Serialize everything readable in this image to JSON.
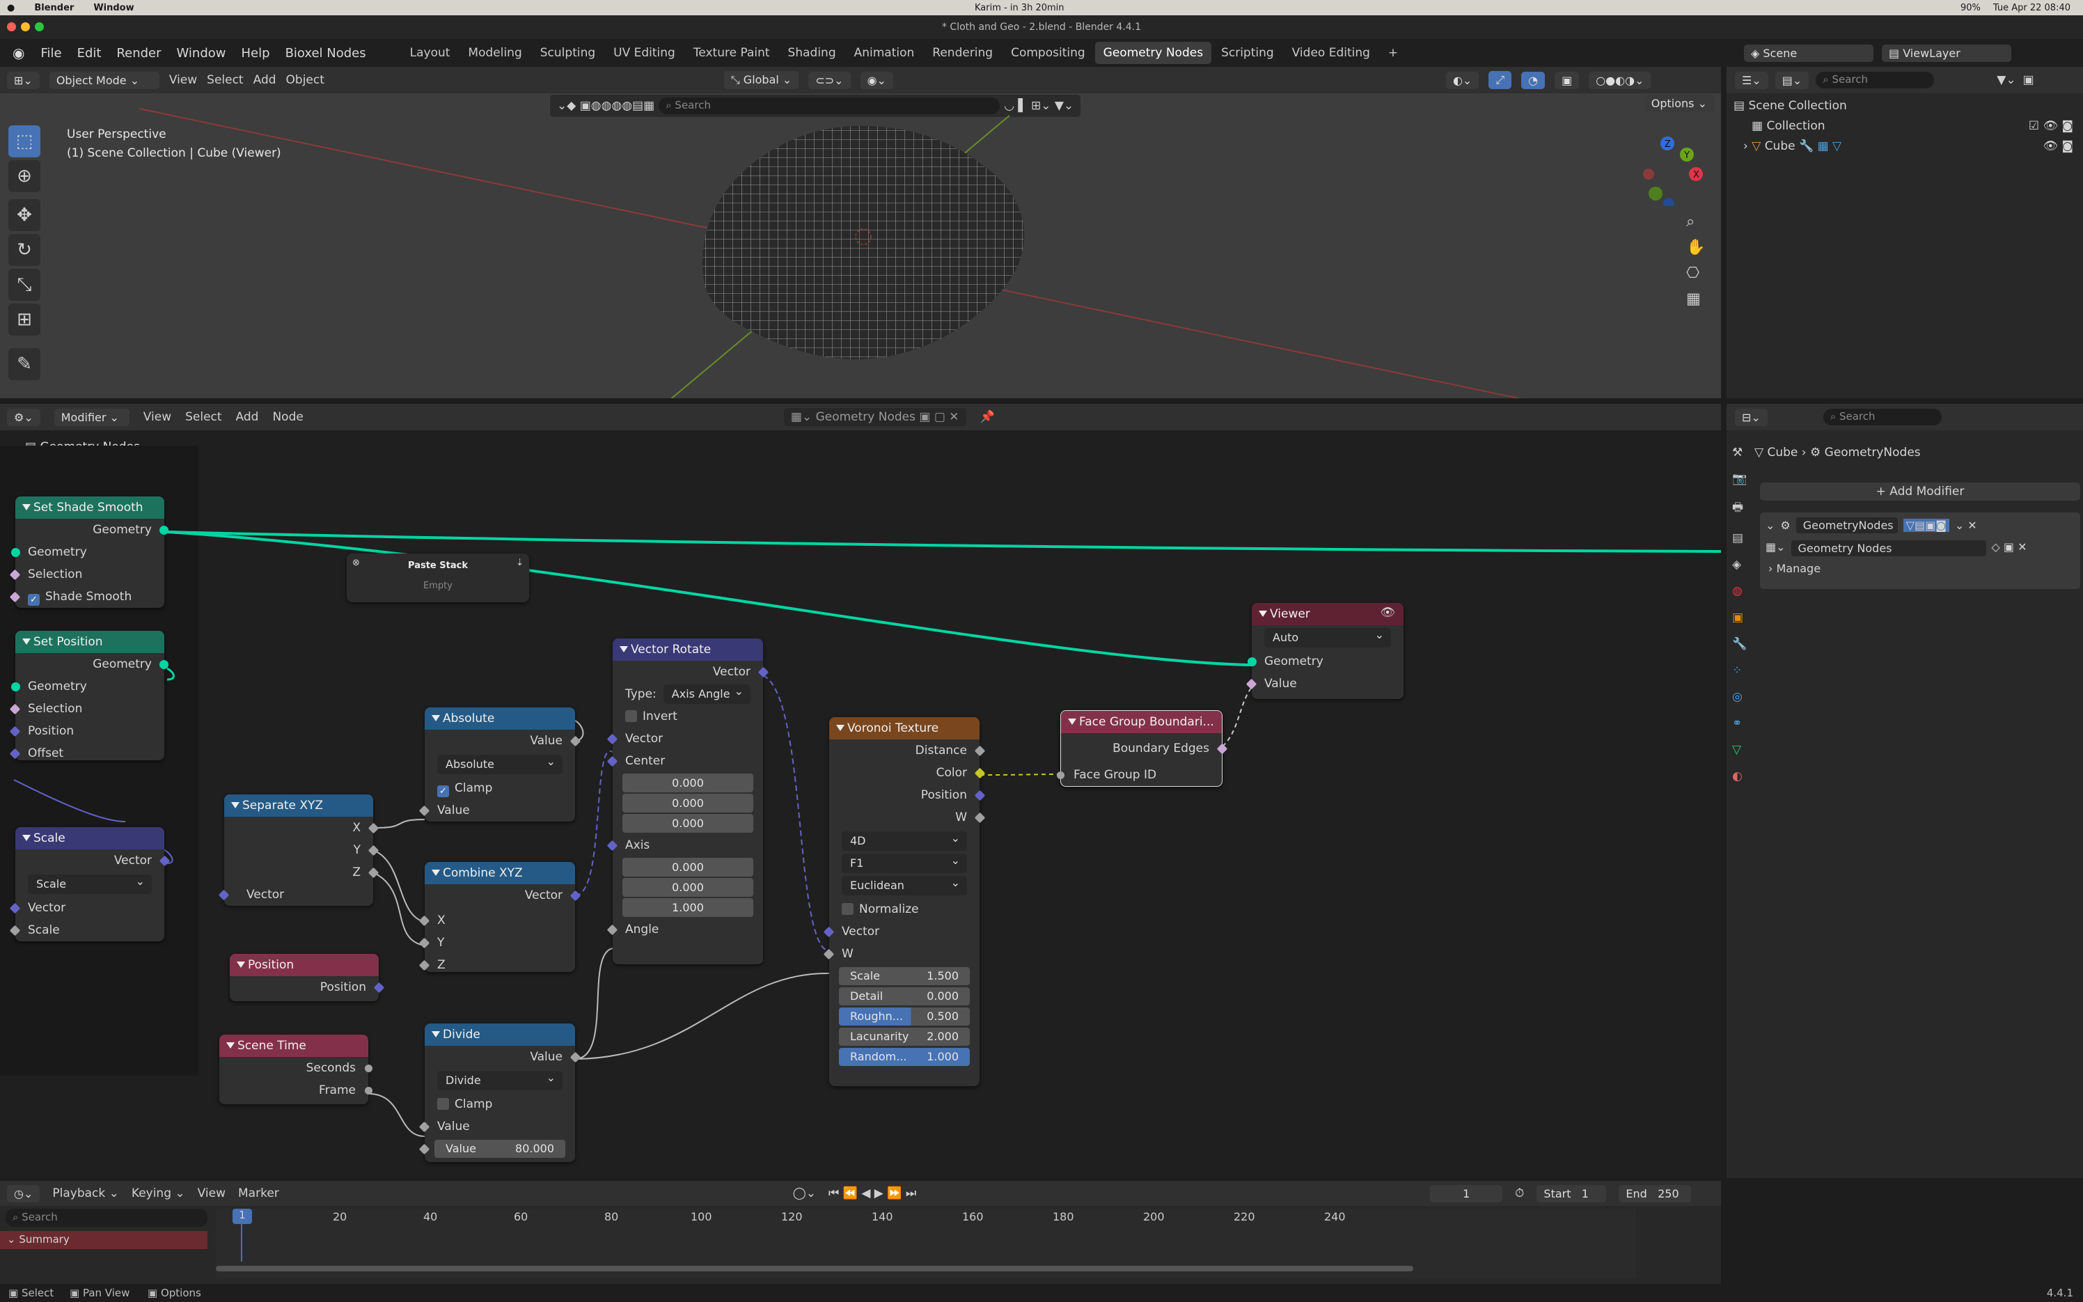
{
  "mac": {
    "app": "Blender",
    "menu_window": "Window",
    "center": "Karim - in 3h 20min",
    "battery": "90%",
    "date": "Tue Apr 22  08:40"
  },
  "window": {
    "title": "* Cloth and Geo - 2.blend - Blender 4.4.1"
  },
  "menu": {
    "file": "File",
    "edit": "Edit",
    "render": "Render",
    "window": "Window",
    "help": "Help",
    "addon": "Bioxel Nodes"
  },
  "workspaces": [
    "Layout",
    "Modeling",
    "Sculpting",
    "UV Editing",
    "Texture Paint",
    "Shading",
    "Animation",
    "Rendering",
    "Compositing",
    "Geometry Nodes",
    "Scripting",
    "Video Editing"
  ],
  "scene": {
    "name": "Scene",
    "viewlayer": "ViewLayer"
  },
  "viewport": {
    "mode": "Object Mode",
    "view": "View",
    "select": "Select",
    "add": "Add",
    "object": "Object",
    "transform": "Global",
    "search_placeholder": "Search",
    "options": "Options",
    "info1": "User Perspective",
    "info2": "(1) Scene Collection | Cube (Viewer)"
  },
  "outliner": {
    "search_placeholder": "Search",
    "root": "Scene Collection",
    "collection": "Collection",
    "object": "Cube"
  },
  "node_editor": {
    "type": "Modifier",
    "view": "View",
    "select": "Select",
    "add": "Add",
    "node": "Node",
    "tree_name": "Geometry Nodes",
    "breadcrumb": "Geometry Nodes"
  },
  "nodes": {
    "shade_smooth": {
      "title": "Set Shade Smooth",
      "out": "Geometry",
      "in1": "Geometry",
      "in2": "Selection",
      "in3": "Shade Smooth"
    },
    "set_position": {
      "title": "Set Position",
      "out": "Geometry",
      "in1": "Geometry",
      "in2": "Selection",
      "in3": "Position",
      "in4": "Offset"
    },
    "scale": {
      "title": "Scale",
      "out": "Vector",
      "mode": "Scale",
      "in1": "Vector",
      "in2": "Scale"
    },
    "paste": {
      "title": "Paste Stack",
      "body": "Empty"
    },
    "separate": {
      "title": "Separate XYZ",
      "x": "X",
      "y": "Y",
      "z": "Z",
      "in": "Vector"
    },
    "position": {
      "title": "Position",
      "out": "Position"
    },
    "scene_time": {
      "title": "Scene Time",
      "s": "Seconds",
      "f": "Frame"
    },
    "absolute": {
      "title": "Absolute",
      "out": "Value",
      "mode": "Absolute",
      "clamp": "Clamp",
      "in": "Value"
    },
    "combine": {
      "title": "Combine XYZ",
      "out": "Vector",
      "x": "X",
      "y": "Y",
      "z": "Z"
    },
    "divide": {
      "title": "Divide",
      "out": "Value",
      "mode": "Divide",
      "clamp": "Clamp",
      "in": "Value",
      "vlabel": "Value",
      "vval": "80.000"
    },
    "vrot": {
      "title": "Vector Rotate",
      "out": "Vector",
      "type_label": "Type:",
      "type": "Axis Angle",
      "invert": "Invert",
      "vec": "Vector",
      "center": "Center",
      "c1": "0.000",
      "c2": "0.000",
      "c3": "0.000",
      "axis": "Axis",
      "a1": "0.000",
      "a2": "0.000",
      "a3": "1.000",
      "angle": "Angle"
    },
    "voronoi": {
      "title": "Voronoi Texture",
      "o1": "Distance",
      "o2": "Color",
      "o3": "Position",
      "o4": "W",
      "dim": "4D",
      "feat": "F1",
      "metric": "Euclidean",
      "norm": "Normalize",
      "vec": "Vector",
      "w": "W",
      "scale_l": "Scale",
      "scale_v": "1.500",
      "detail_l": "Detail",
      "detail_v": "0.000",
      "rough_l": "Roughn...",
      "rough_v": "0.500",
      "lac_l": "Lacunarity",
      "lac_v": "2.000",
      "rand_l": "Random...",
      "rand_v": "1.000"
    },
    "fgb": {
      "title": "Face Group Boundari...",
      "out": "Boundary Edges",
      "in": "Face Group ID"
    },
    "viewer": {
      "title": "Viewer",
      "mode": "Auto",
      "g": "Geometry",
      "v": "Value"
    }
  },
  "props": {
    "search_placeholder": "Search",
    "obj": "Cube",
    "mod": "GeometryNodes",
    "add": "Add Modifier",
    "mod_name": "GeometryNodes",
    "tree": "Geometry Nodes",
    "manage": "Manage"
  },
  "timeline": {
    "playback": "Playback",
    "keying": "Keying",
    "view": "View",
    "marker": "Marker",
    "frame": "1",
    "start_l": "Start",
    "start": "1",
    "end_l": "End",
    "end": "250",
    "search_placeholder": "Search",
    "summary": "Summary",
    "ticks": [
      "1",
      "20",
      "40",
      "60",
      "80",
      "100",
      "120",
      "140",
      "160",
      "180",
      "200",
      "220",
      "240"
    ]
  },
  "status": {
    "select": "Select",
    "pan": "Pan View",
    "options": "Options",
    "version": "4.4.1"
  }
}
